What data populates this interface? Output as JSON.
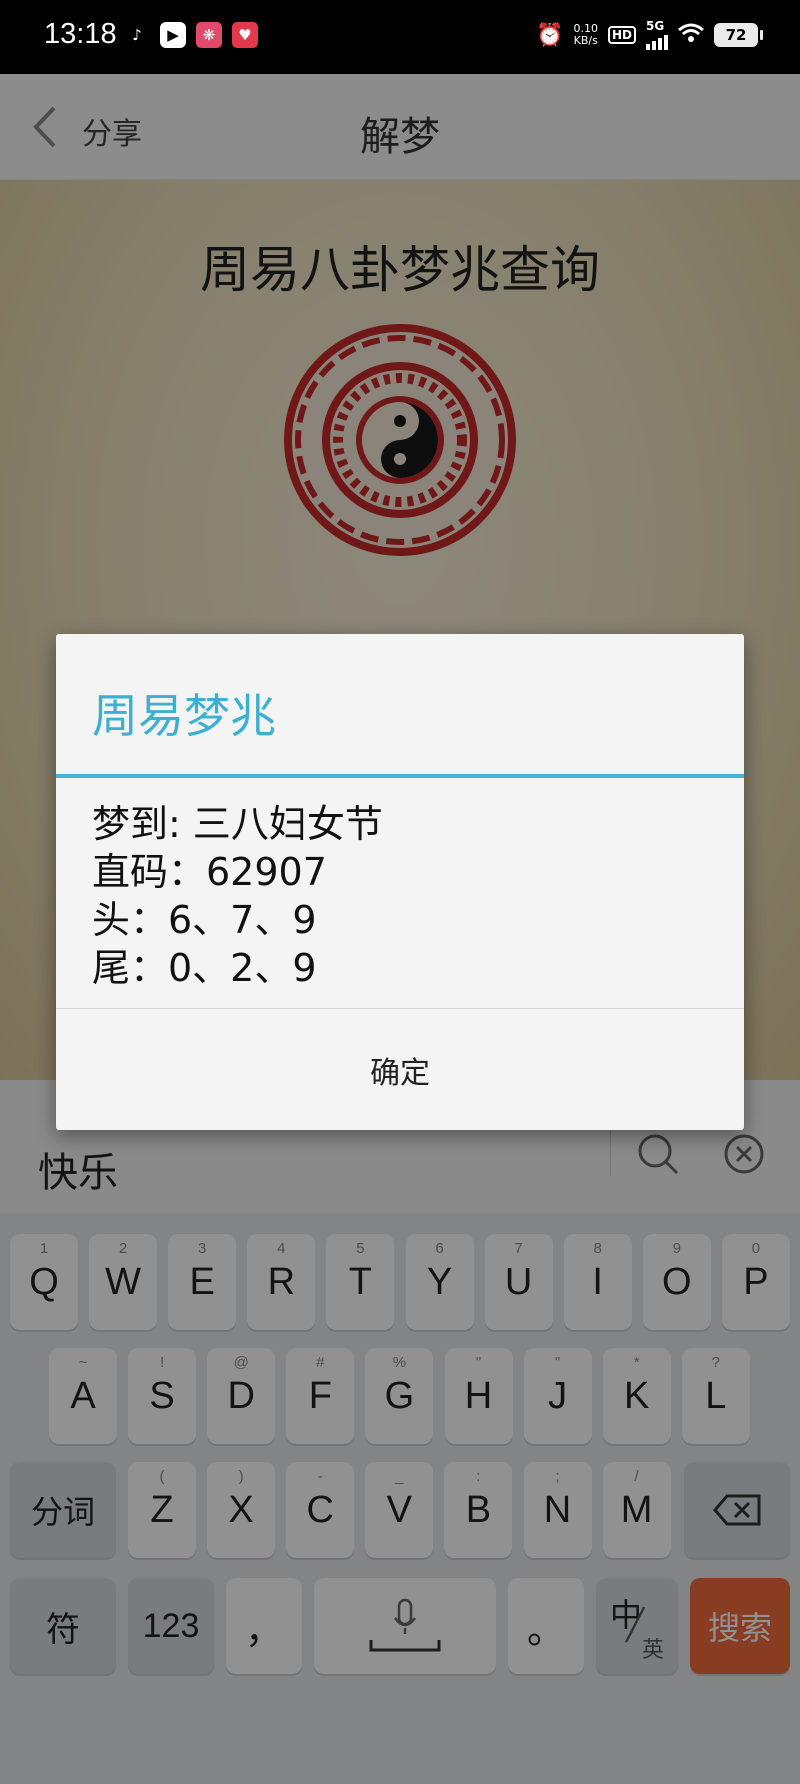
{
  "status_bar": {
    "time": "13:18",
    "net_speed_value": "0.10",
    "net_speed_unit": "KB/s",
    "hd": "HD",
    "network": "5G",
    "battery": "72",
    "icons": [
      "tiktok-icon",
      "music-icon",
      "app-icon",
      "app-icon",
      "alarm-icon",
      "wifi-icon"
    ]
  },
  "header": {
    "back_label": "分享",
    "title": "解梦"
  },
  "page": {
    "title": "周易八卦梦兆查询"
  },
  "search": {
    "value": "快乐"
  },
  "dialog": {
    "title": "周易梦兆",
    "lines": [
      "梦到: 三八妇女节",
      "直码：62907",
      "头：6、7、9",
      "尾：0、2、9"
    ],
    "ok_label": "确定"
  },
  "keyboard": {
    "row1": [
      {
        "key": "Q",
        "sub": "1"
      },
      {
        "key": "W",
        "sub": "2"
      },
      {
        "key": "E",
        "sub": "3"
      },
      {
        "key": "R",
        "sub": "4"
      },
      {
        "key": "T",
        "sub": "5"
      },
      {
        "key": "Y",
        "sub": "6"
      },
      {
        "key": "U",
        "sub": "7"
      },
      {
        "key": "I",
        "sub": "8"
      },
      {
        "key": "O",
        "sub": "9"
      },
      {
        "key": "P",
        "sub": "0"
      }
    ],
    "row2": [
      {
        "key": "A",
        "sub": "~"
      },
      {
        "key": "S",
        "sub": "!"
      },
      {
        "key": "D",
        "sub": "@"
      },
      {
        "key": "F",
        "sub": "#"
      },
      {
        "key": "G",
        "sub": "%"
      },
      {
        "key": "H",
        "sub": "\""
      },
      {
        "key": "J",
        "sub": "\""
      },
      {
        "key": "K",
        "sub": "*"
      },
      {
        "key": "L",
        "sub": "?"
      }
    ],
    "row3": [
      {
        "key": "Z",
        "sub": "("
      },
      {
        "key": "X",
        "sub": ")"
      },
      {
        "key": "C",
        "sub": "-"
      },
      {
        "key": "V",
        "sub": "_"
      },
      {
        "key": "B",
        "sub": ":"
      },
      {
        "key": "N",
        "sub": ";"
      },
      {
        "key": "M",
        "sub": "/"
      }
    ],
    "fenci": "分词",
    "fu": "符",
    "num": "123",
    "comma": "，",
    "period": "。",
    "lang_main": "中",
    "lang_alt": "英",
    "search_key": "搜索"
  }
}
